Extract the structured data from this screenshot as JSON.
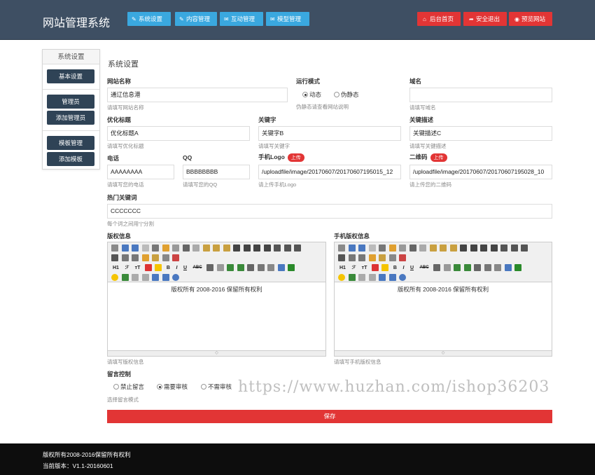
{
  "header": {
    "brand": "网站管理系统",
    "nav": [
      {
        "icon": "wrench-icon",
        "glyph": "✎",
        "label": "系统设置"
      },
      {
        "icon": "edit-icon",
        "glyph": "✎",
        "label": "内容管理"
      },
      {
        "icon": "mail-icon",
        "glyph": "✉",
        "label": "互动管理"
      },
      {
        "icon": "mail-icon",
        "glyph": "✉",
        "label": "模型管理"
      }
    ],
    "right": [
      {
        "icon": "home-icon",
        "glyph": "⌂",
        "label": "后台首页"
      },
      {
        "icon": "logout-icon",
        "glyph": "➦",
        "label": "安全退出"
      },
      {
        "icon": "eye-icon",
        "glyph": "◉",
        "label": "预览网站"
      }
    ]
  },
  "sidebar": {
    "title": "系统设置",
    "items": [
      "基本设置",
      "管理员",
      "添加管理员",
      "模板管理",
      "添加模板"
    ]
  },
  "page": {
    "title": "系统设置"
  },
  "form": {
    "site_name": {
      "label": "网站名称",
      "value": "通辽信息港",
      "hint": "请填写网站名称"
    },
    "run_mode": {
      "label": "运行模式",
      "options": [
        "动态",
        "伪静态"
      ],
      "selected": "动态",
      "hint": "伪静态请查看网站说明"
    },
    "domain": {
      "label": "域名",
      "value": "",
      "hint": "请填写域名"
    },
    "seo_title": {
      "label": "优化标题",
      "value": "优化标题A",
      "hint": "请填写优化标题"
    },
    "keywords": {
      "label": "关键字",
      "value": "关键字B",
      "hint": "请填写关键字"
    },
    "description": {
      "label": "关键描述",
      "value": "关键描述C",
      "hint": "请填写关键描述"
    },
    "phone": {
      "label": "电话",
      "value": "AAAAAAAA",
      "hint": "请填写您的电话"
    },
    "qq": {
      "label": "QQ",
      "value": "BBBBBBBB",
      "hint": "请填写您的QQ"
    },
    "mobile_logo": {
      "label": "手机Logo",
      "badge": "上传",
      "value": "/uploadfile/image/20170607/20170607195015_12",
      "hint": "请上传手机Logo"
    },
    "qrcode": {
      "label": "二维码",
      "badge": "上传",
      "value": "/uploadfile/image/20170607/20170607195028_10",
      "hint": "请上传您的二维码"
    },
    "hot_keywords": {
      "label": "热门关键词",
      "value": "CCCCCCC",
      "hint": "每个词之间用“|”分割"
    },
    "copyright": {
      "label": "版权信息",
      "content": "版权所有 2008-2016 保留所有权利",
      "hint": "请填写版权信息"
    },
    "mobile_copyright": {
      "label": "手机版权信息",
      "content": "版权所有 2008-2016 保留所有权利",
      "hint": "请填写手机版权信息"
    },
    "comment": {
      "label": "留言控制",
      "options": [
        "禁止留言",
        "需要审核",
        "不需审核"
      ],
      "selected": "需要审核",
      "hint": "选择留言模式"
    },
    "save_label": "保存"
  },
  "editor_toolbar": {
    "heading": "H1",
    "font": "ℱ",
    "size": "тT",
    "bold": "B",
    "italic": "I",
    "underline": "U",
    "strike": "ABC"
  },
  "footer": {
    "copyright": "版权所有2008-2016保留所有权利",
    "version": "当前版本：V1.1-20160601"
  },
  "watermark": "https://www.huzhan.com/ishop36203",
  "colors": {
    "header": "#3e4f63",
    "nav_button": "#3aa8df",
    "danger": "#e23535",
    "sidebar_button": "#2f4356",
    "footer": "#0d0d0d"
  }
}
